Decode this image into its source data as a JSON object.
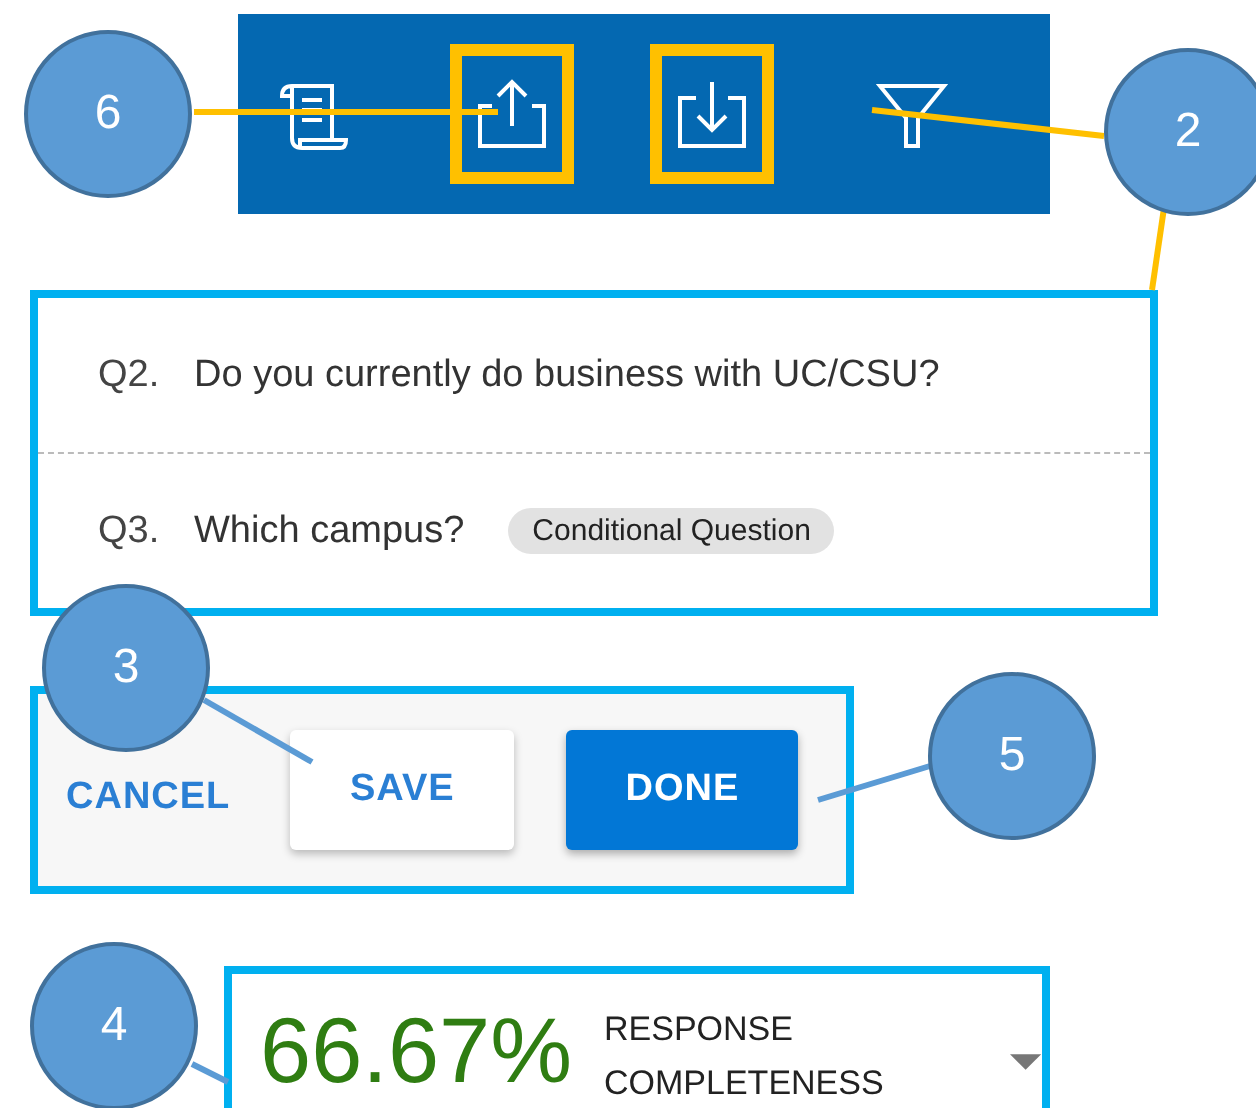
{
  "toolbar": {
    "buttons": [
      {
        "highlighted": false
      },
      {
        "highlighted": true
      },
      {
        "highlighted": true
      },
      {
        "highlighted": false
      }
    ]
  },
  "questions": [
    {
      "number": "Q2.",
      "text": "Do you currently do business with UC/CSU?"
    },
    {
      "number": "Q3.",
      "text": "Which campus?",
      "tag": "Conditional Question"
    }
  ],
  "actions": [
    {
      "label": "CANCEL",
      "kind": "text"
    },
    {
      "label": "SAVE",
      "kind": "outlined"
    },
    {
      "label": "DONE",
      "kind": "primary"
    }
  ],
  "completeness": {
    "value": "66.67%",
    "label": "RESPONSE COMPLETENESS"
  },
  "callouts": [
    {
      "number": "6"
    },
    {
      "number": "2"
    },
    {
      "number": "3"
    },
    {
      "number": "5"
    },
    {
      "number": "4"
    }
  ]
}
